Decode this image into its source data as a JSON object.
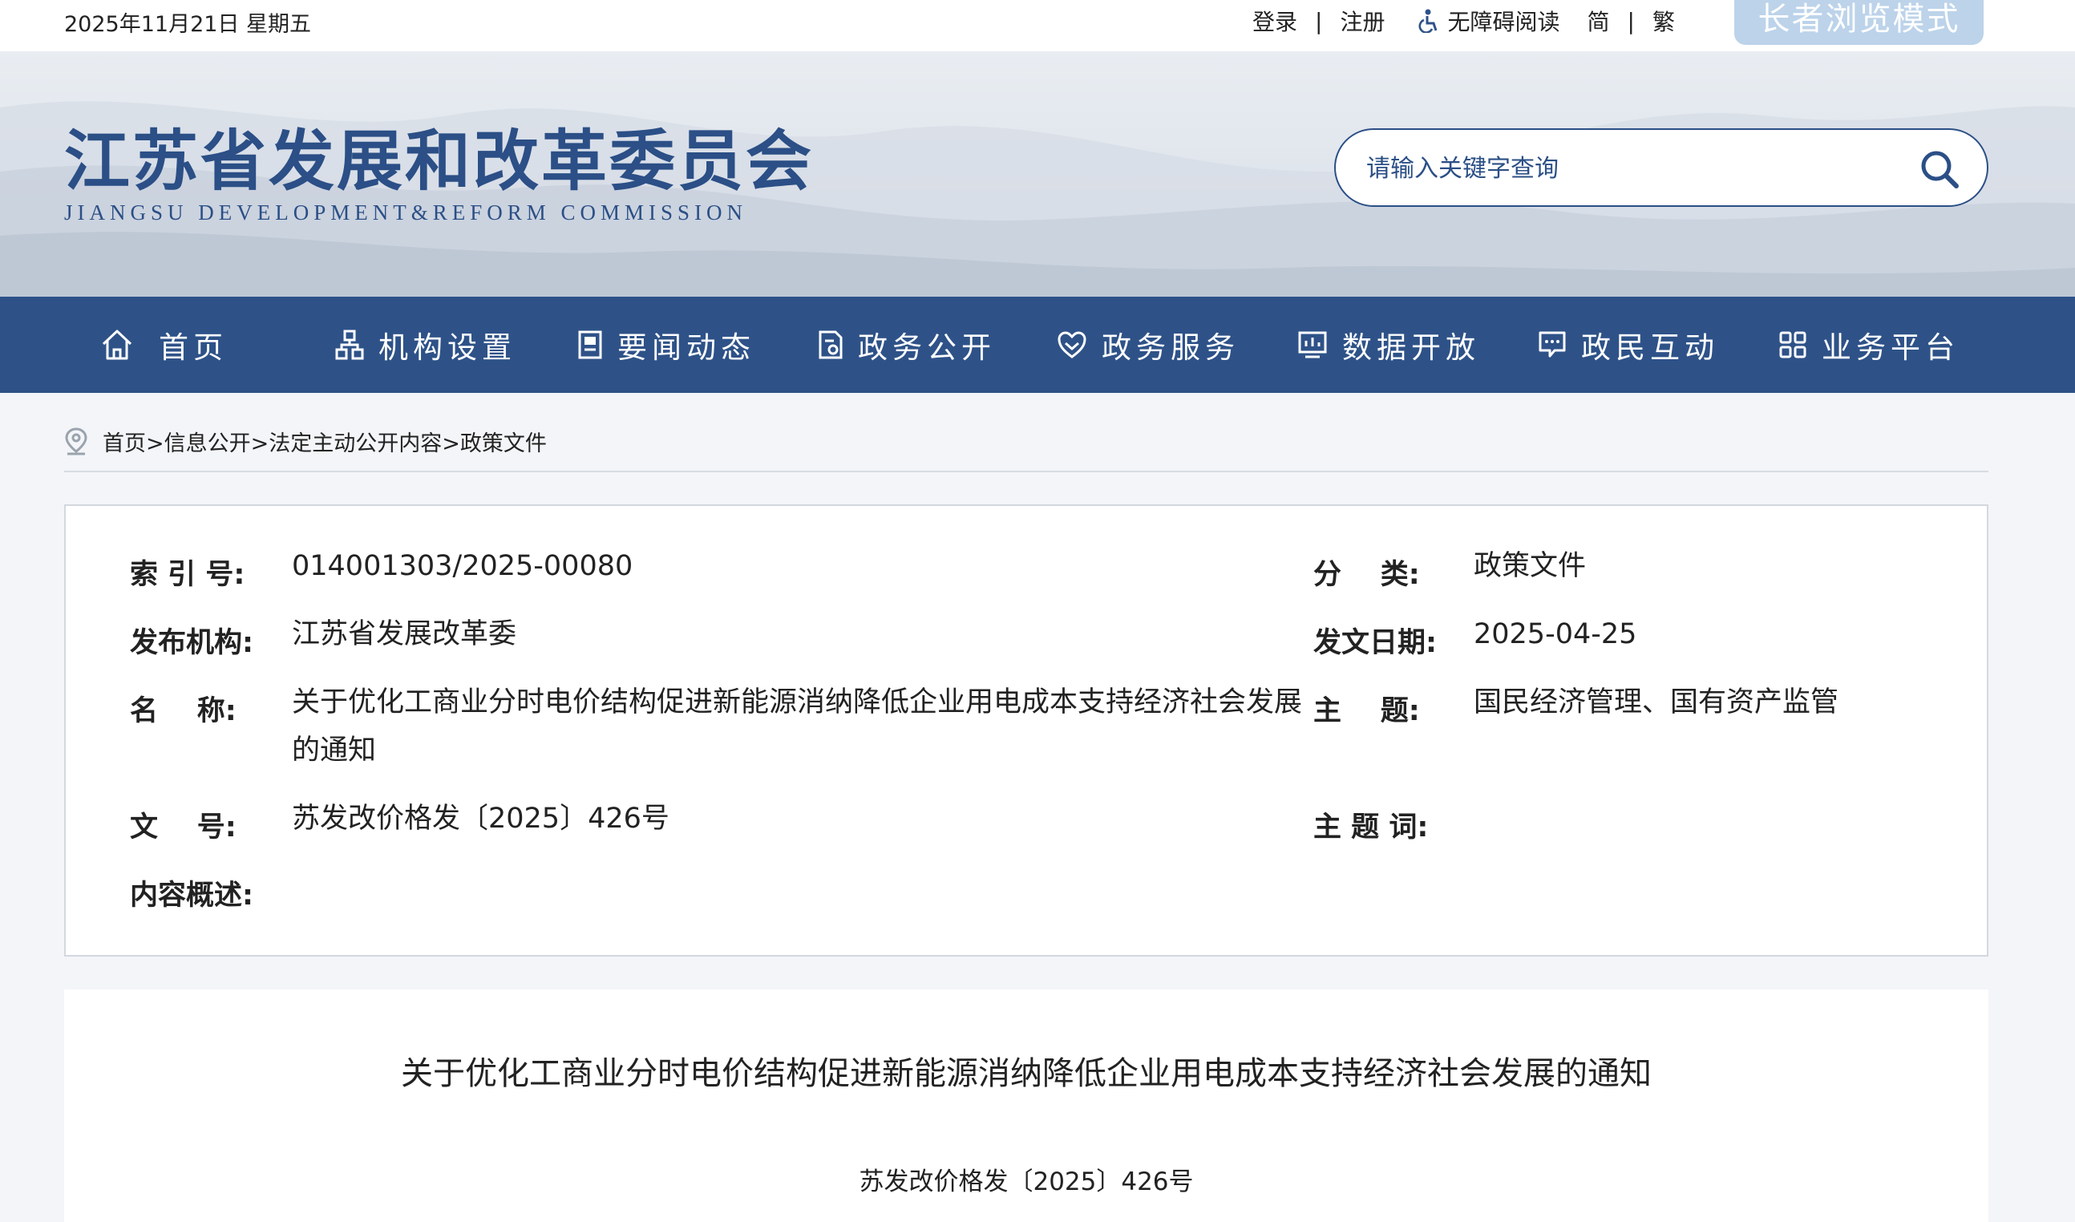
{
  "topbar": {
    "date": "2025年11月21日 星期五",
    "login": "登录",
    "sep": "|",
    "register": "注册",
    "accessibility": "无障碍阅读",
    "simplified": "简",
    "traditional": "繁",
    "elder_mode": "长者浏览模式"
  },
  "header": {
    "title": "江苏省发展和改革委员会",
    "subtitle": "JIANGSU DEVELOPMENT&REFORM COMMISSION",
    "search_placeholder": "请输入关键字查询"
  },
  "nav": [
    {
      "label": "首页",
      "icon": "home-icon"
    },
    {
      "label": "机构设置",
      "icon": "org-icon"
    },
    {
      "label": "要闻动态",
      "icon": "news-icon"
    },
    {
      "label": "政务公开",
      "icon": "doc-icon"
    },
    {
      "label": "政务服务",
      "icon": "service-icon"
    },
    {
      "label": "数据开放",
      "icon": "data-icon"
    },
    {
      "label": "政民互动",
      "icon": "chat-icon"
    },
    {
      "label": "业务平台",
      "icon": "grid-icon"
    }
  ],
  "breadcrumb": {
    "items": [
      "首页>",
      "信息公开>",
      "法定主动公开内容>",
      "政策文件"
    ]
  },
  "info": {
    "index_label": "索 引 号:",
    "index_value": "014001303/2025-00080",
    "category_label": "分    类:",
    "category_value": "政策文件",
    "publisher_label": "发布机构:",
    "publisher_value": "江苏省发展改革委",
    "date_label": "发文日期:",
    "date_value": "2025-04-25",
    "name_label": "名    称:",
    "name_value": "关于优化工商业分时电价结构促进新能源消纳降低企业用电成本支持经济社会发展的通知",
    "topic_label": "主    题:",
    "topic_value": "国民经济管理、国有资产监管",
    "docno_label": "文    号:",
    "docno_value": "苏发改价格发〔2025〕426号",
    "keywords_label": "主 题 词:",
    "summary_label": "内容概述:"
  },
  "article": {
    "title": "关于优化工商业分时电价结构促进新能源消纳降低企业用电成本支持经济社会发展的通知",
    "doc_number": "苏发改价格发〔2025〕426号"
  },
  "colors": {
    "brand": "#2e5288",
    "title": "#2b4f86",
    "elder_button": "#bcd3ea"
  }
}
